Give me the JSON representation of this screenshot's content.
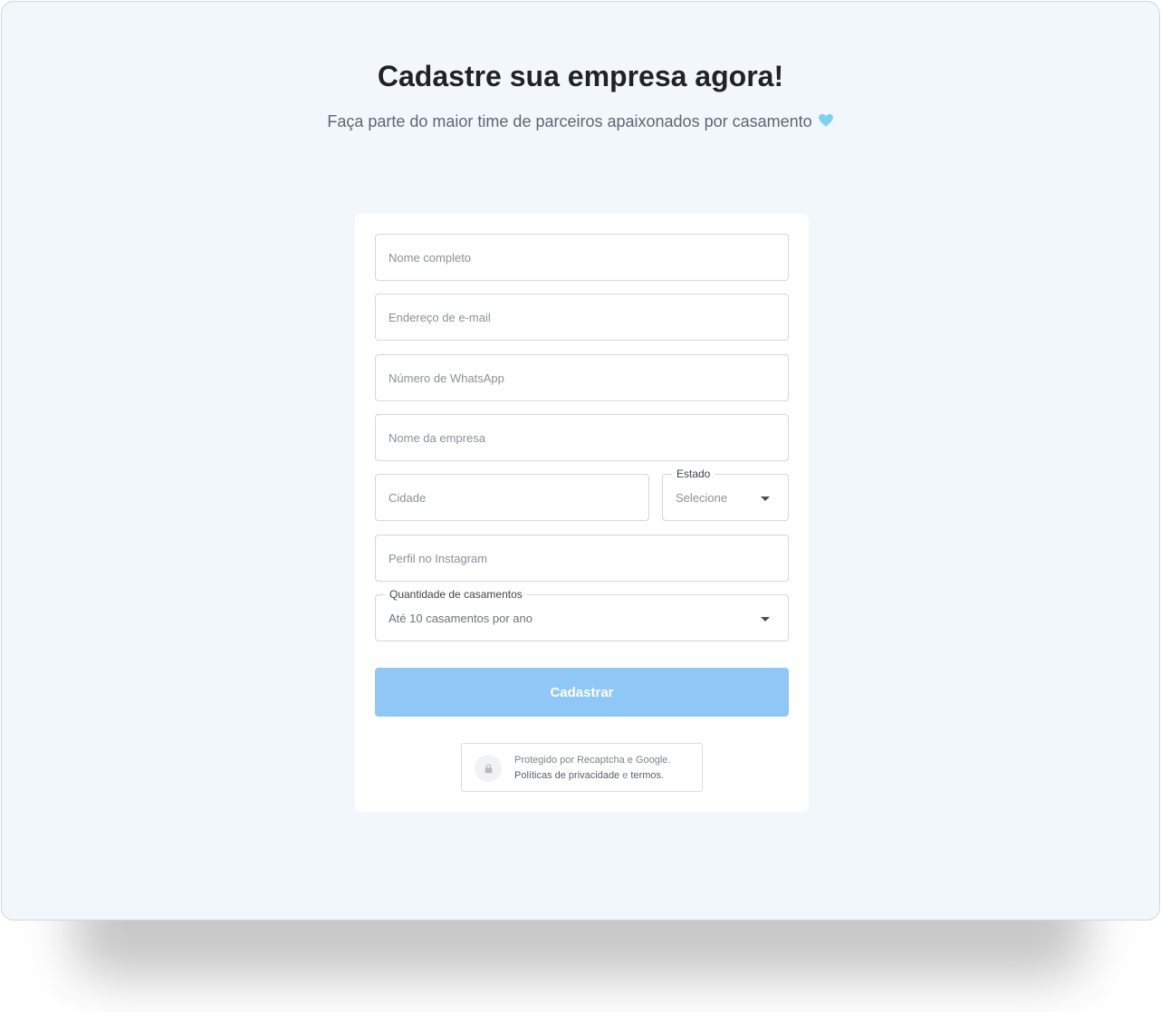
{
  "header": {
    "title": "Cadastre sua empresa agora!",
    "subtitle": "Faça parte do maior time de parceiros apaixonados por casamento"
  },
  "form": {
    "full_name": {
      "placeholder": "Nome completo",
      "value": ""
    },
    "email": {
      "placeholder": "Endereço de e-mail",
      "value": ""
    },
    "whatsapp": {
      "placeholder": "Número de WhatsApp",
      "value": ""
    },
    "company": {
      "placeholder": "Nome da empresa",
      "value": ""
    },
    "city": {
      "placeholder": "Cidade",
      "value": ""
    },
    "state": {
      "label": "Estado",
      "selected": "Selecione"
    },
    "instagram": {
      "placeholder": "Perfil no Instagram",
      "value": ""
    },
    "weddings": {
      "label": "Quantidade de casamentos",
      "selected": "Até 10 casamentos por ano"
    },
    "submit_label": "Cadastrar"
  },
  "recaptcha": {
    "line1": "Protegido por Recaptcha e Google.",
    "privacy_link": "Políticas de privacidade",
    "conjunction": " e ",
    "terms_link": "termos",
    "period": "."
  },
  "colors": {
    "background": "#f2f7fb",
    "button": "#8fc7f7",
    "heart": "#7ed0f2"
  },
  "icons": {
    "heart": "light-blue-heart-icon",
    "lock": "lock-icon",
    "caret": "caret-down-icon"
  }
}
